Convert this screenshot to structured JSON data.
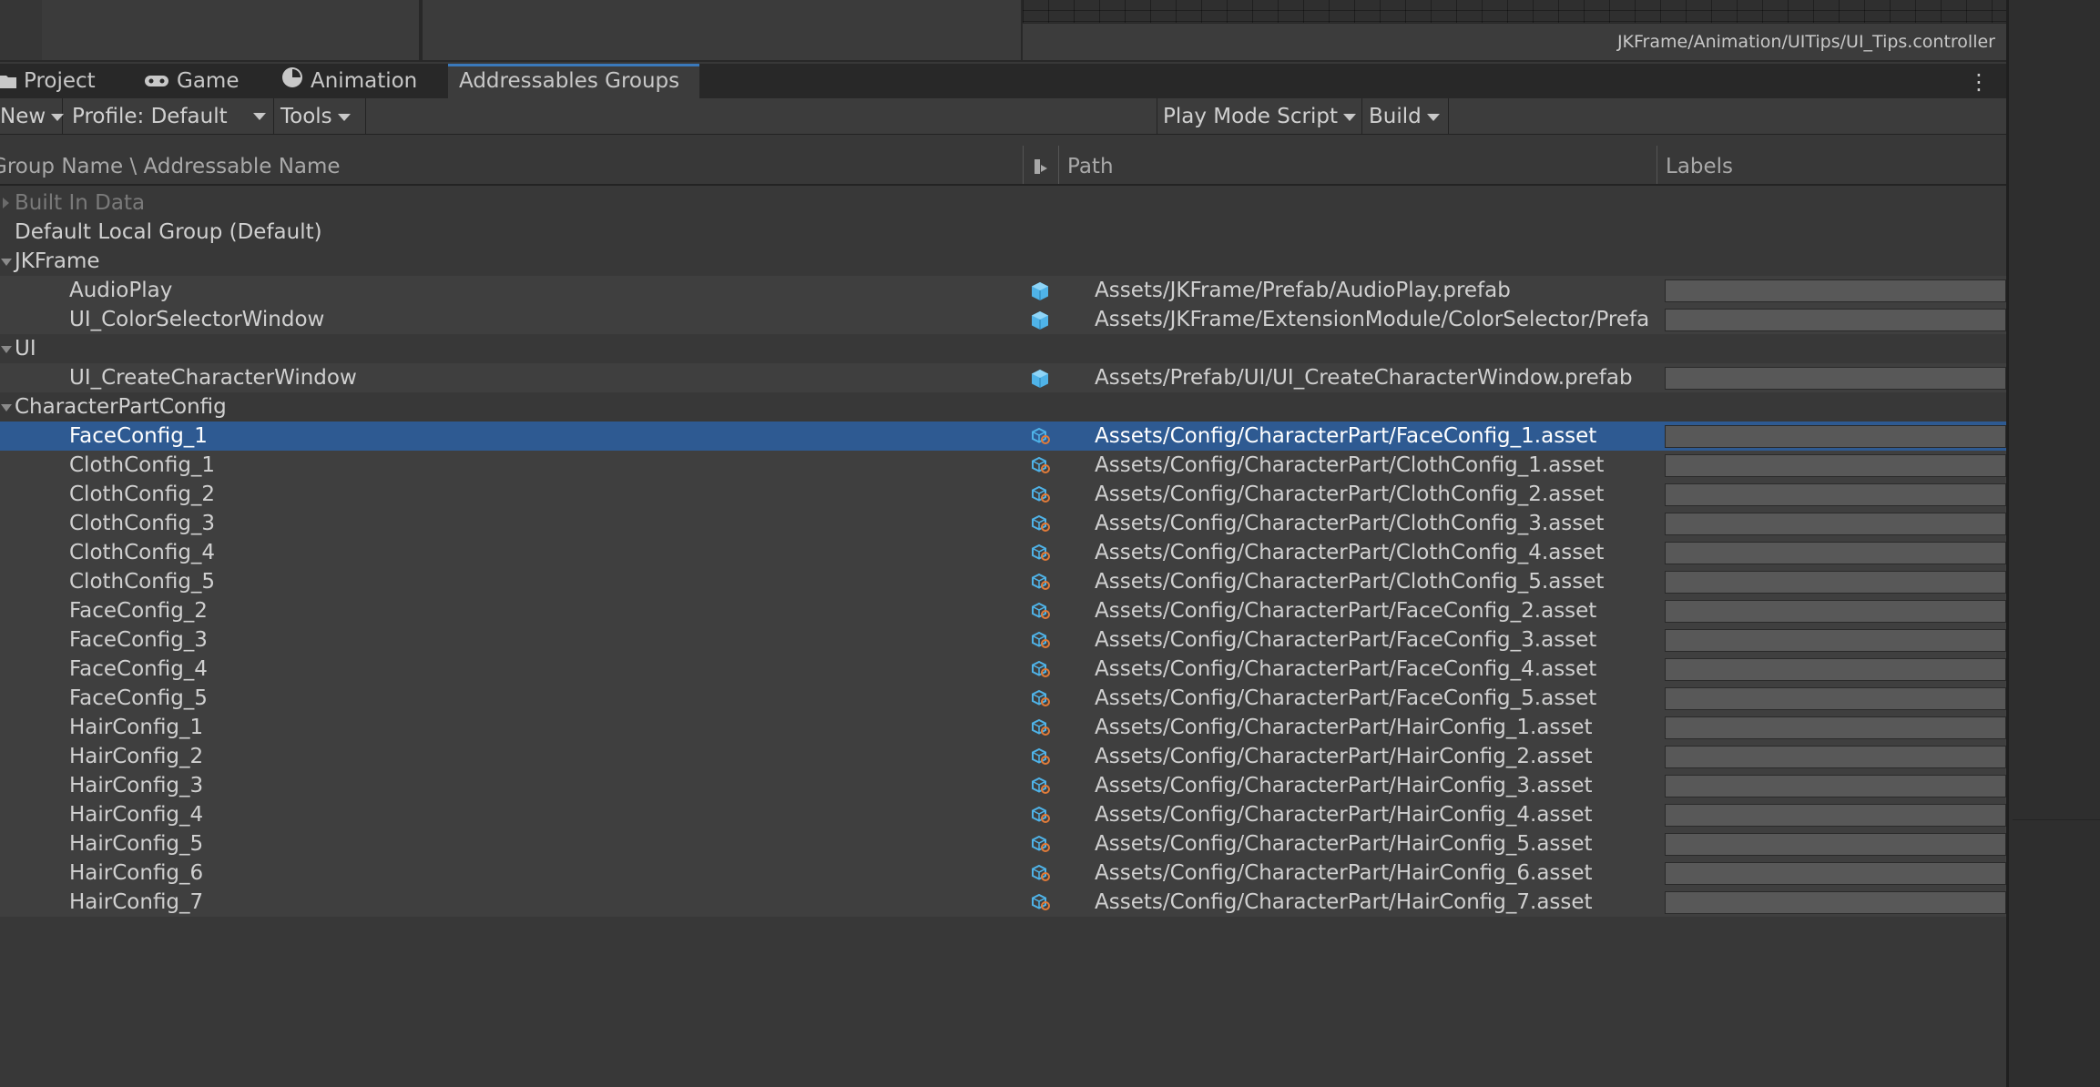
{
  "path_bar": {
    "text": "JKFrame/Animation/UITips/UI_Tips.controller"
  },
  "tabs": [
    {
      "label": "Project",
      "icon": "folder-icon"
    },
    {
      "label": "Game",
      "icon": "gamepad-icon"
    },
    {
      "label": "Animation",
      "icon": "clock-icon"
    },
    {
      "label": "Addressables Groups",
      "active": true
    }
  ],
  "toolbar": {
    "new_label": "New",
    "profile_label": "Profile: Default",
    "tools_label": "Tools",
    "play_mode_label": "Play Mode Script",
    "build_label": "Build"
  },
  "columns": {
    "name": "Group Name \\ Addressable Name",
    "path": "Path",
    "labels": "Labels"
  },
  "rows": [
    {
      "kind": "group",
      "label": "Built In Data",
      "expanded": false,
      "disabled": true
    },
    {
      "kind": "group",
      "label": "Default Local Group (Default)",
      "expanded": null
    },
    {
      "kind": "group",
      "label": "JKFrame",
      "expanded": true
    },
    {
      "kind": "entry",
      "label": "AudioPlay",
      "icon": "prefab-icon",
      "path": "Assets/JKFrame/Prefab/AudioPlay.prefab"
    },
    {
      "kind": "entry",
      "label": "UI_ColorSelectorWindow",
      "icon": "prefab-icon",
      "path": "Assets/JKFrame/ExtensionModule/ColorSelector/Prefa"
    },
    {
      "kind": "group",
      "label": "UI",
      "expanded": true
    },
    {
      "kind": "entry",
      "label": "UI_CreateCharacterWindow",
      "icon": "prefab-icon",
      "path": "Assets/Prefab/UI/UI_CreateCharacterWindow.prefab"
    },
    {
      "kind": "group",
      "label": "CharacterPartConfig",
      "expanded": true
    },
    {
      "kind": "entry",
      "label": "FaceConfig_1",
      "icon": "scriptable-object-icon",
      "path": "Assets/Config/CharacterPart/FaceConfig_1.asset",
      "selected": true
    },
    {
      "kind": "entry",
      "label": "ClothConfig_1",
      "icon": "scriptable-object-icon",
      "path": "Assets/Config/CharacterPart/ClothConfig_1.asset"
    },
    {
      "kind": "entry",
      "label": "ClothConfig_2",
      "icon": "scriptable-object-icon",
      "path": "Assets/Config/CharacterPart/ClothConfig_2.asset"
    },
    {
      "kind": "entry",
      "label": "ClothConfig_3",
      "icon": "scriptable-object-icon",
      "path": "Assets/Config/CharacterPart/ClothConfig_3.asset"
    },
    {
      "kind": "entry",
      "label": "ClothConfig_4",
      "icon": "scriptable-object-icon",
      "path": "Assets/Config/CharacterPart/ClothConfig_4.asset"
    },
    {
      "kind": "entry",
      "label": "ClothConfig_5",
      "icon": "scriptable-object-icon",
      "path": "Assets/Config/CharacterPart/ClothConfig_5.asset"
    },
    {
      "kind": "entry",
      "label": "FaceConfig_2",
      "icon": "scriptable-object-icon",
      "path": "Assets/Config/CharacterPart/FaceConfig_2.asset"
    },
    {
      "kind": "entry",
      "label": "FaceConfig_3",
      "icon": "scriptable-object-icon",
      "path": "Assets/Config/CharacterPart/FaceConfig_3.asset"
    },
    {
      "kind": "entry",
      "label": "FaceConfig_4",
      "icon": "scriptable-object-icon",
      "path": "Assets/Config/CharacterPart/FaceConfig_4.asset"
    },
    {
      "kind": "entry",
      "label": "FaceConfig_5",
      "icon": "scriptable-object-icon",
      "path": "Assets/Config/CharacterPart/FaceConfig_5.asset"
    },
    {
      "kind": "entry",
      "label": "HairConfig_1",
      "icon": "scriptable-object-icon",
      "path": "Assets/Config/CharacterPart/HairConfig_1.asset"
    },
    {
      "kind": "entry",
      "label": "HairConfig_2",
      "icon": "scriptable-object-icon",
      "path": "Assets/Config/CharacterPart/HairConfig_2.asset"
    },
    {
      "kind": "entry",
      "label": "HairConfig_3",
      "icon": "scriptable-object-icon",
      "path": "Assets/Config/CharacterPart/HairConfig_3.asset"
    },
    {
      "kind": "entry",
      "label": "HairConfig_4",
      "icon": "scriptable-object-icon",
      "path": "Assets/Config/CharacterPart/HairConfig_4.asset"
    },
    {
      "kind": "entry",
      "label": "HairConfig_5",
      "icon": "scriptable-object-icon",
      "path": "Assets/Config/CharacterPart/HairConfig_5.asset"
    },
    {
      "kind": "entry",
      "label": "HairConfig_6",
      "icon": "scriptable-object-icon",
      "path": "Assets/Config/CharacterPart/HairConfig_6.asset"
    },
    {
      "kind": "entry",
      "label": "HairConfig_7",
      "icon": "scriptable-object-icon",
      "path": "Assets/Config/CharacterPart/HairConfig_7.asset"
    }
  ],
  "colors": {
    "selection": "#2e5a92",
    "tab_accent": "#3a79bb",
    "icon_blue": "#4fb3e8",
    "icon_orange": "#e07b39"
  }
}
